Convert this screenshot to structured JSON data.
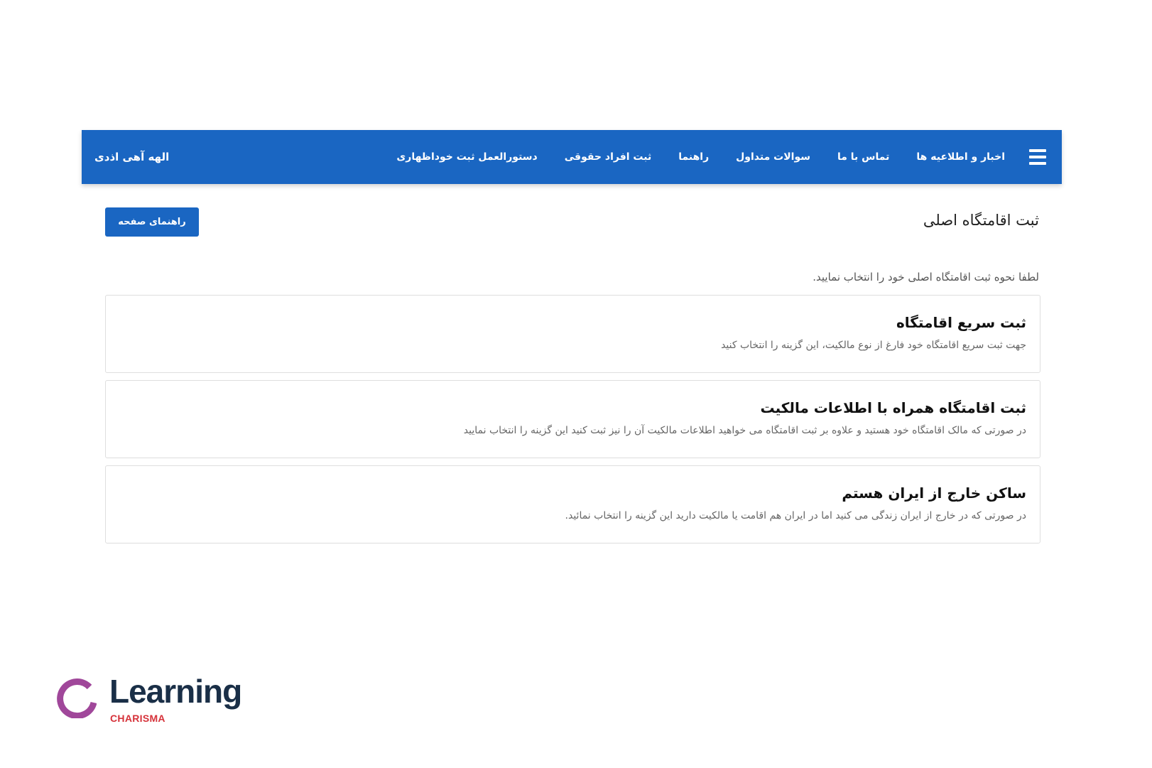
{
  "navbar": {
    "menu_icon": "hamburger-icon",
    "items": [
      {
        "label": "اخبار و اطلاعیه ها"
      },
      {
        "label": "تماس با ما"
      },
      {
        "label": "سوالات متداول"
      },
      {
        "label": "راهنما"
      },
      {
        "label": "ثبت افراد حقوقی"
      },
      {
        "label": "دستورالعمل ثبت خوداظهاری"
      }
    ],
    "user_name": "الهه آهی اذدی",
    "background_color": "#1a66c2"
  },
  "page": {
    "title": "ثبت اقامتگاه اصلی",
    "help_button": "راهنمای صفحه",
    "instruction": "لطفا نحوه ثبت اقامتگاه اصلی خود را انتخاب نمایید."
  },
  "options": [
    {
      "title": "ثبت سریع اقامتگاه",
      "description": "جهت ثبت سریع اقامتگاه خود فارغ از نوع مالکیت، این گزینه را انتخاب کنید"
    },
    {
      "title": "ثبت اقامتگاه همراه با اطلاعات مالکیت",
      "description": "در صورتی که مالک اقامتگاه خود هستید و علاوه بر ثبت اقامتگاه می خواهید اطلاعات مالکیت آن را نیز ثبت کنید این گزینه را انتخاب نمایید"
    },
    {
      "title": "ساکن خارج از ایران هستم",
      "description": "در صورتی که در خارج از ایران زندگی می کنید اما در ایران هم اقامت یا مالکیت دارید این گزینه را انتخاب نمائید."
    }
  ],
  "watermark": {
    "word": "Learning",
    "sub": "CHARISMA",
    "ring_color": "#a0479a",
    "word_color": "#1a2f47",
    "sub_color": "#d6323a"
  }
}
